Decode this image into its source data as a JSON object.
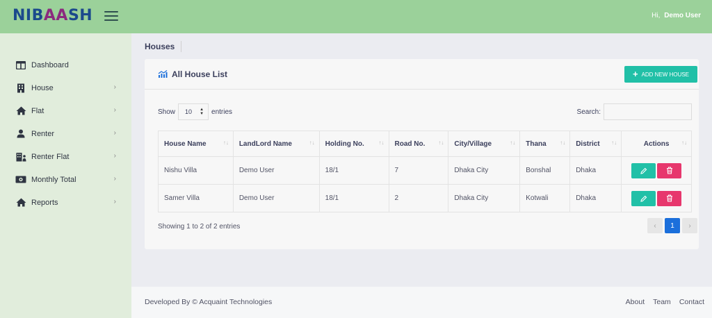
{
  "brand": {
    "logo_pre": "NIB",
    "logo_mid": "AA",
    "logo_post": "SH"
  },
  "header": {
    "greeting": "Hi,",
    "user_name": "Demo User"
  },
  "sidebar": {
    "items": [
      {
        "label": "Dashboard",
        "icon": "dashboard-icon",
        "has_chevron": false
      },
      {
        "label": "House",
        "icon": "building-icon",
        "has_chevron": true
      },
      {
        "label": "Flat",
        "icon": "home-icon",
        "has_chevron": true
      },
      {
        "label": "Renter",
        "icon": "user-icon",
        "has_chevron": true
      },
      {
        "label": "Renter Flat",
        "icon": "renter-flat-icon",
        "has_chevron": true
      },
      {
        "label": "Monthly Total",
        "icon": "money-icon",
        "has_chevron": true
      },
      {
        "label": "Reports",
        "icon": "home-icon",
        "has_chevron": true
      }
    ]
  },
  "breadcrumb": "Houses",
  "card": {
    "title": "All House List",
    "add_button": "ADD NEW HOUSE"
  },
  "controls": {
    "show_label": "Show",
    "entries_value": "10",
    "entries_label": "entries",
    "search_label": "Search:",
    "search_value": ""
  },
  "table": {
    "columns": [
      "House Name",
      "LandLord Name",
      "Holding No.",
      "Road No.",
      "City/Village",
      "Thana",
      "District",
      "Actions"
    ],
    "rows": [
      [
        "Nishu Villa",
        "Demo User",
        "18/1",
        "7",
        "Dhaka City",
        "Bonshal",
        "Dhaka"
      ],
      [
        "Samer Villa",
        "Demo User",
        "18/1",
        "2",
        "Dhaka City",
        "Kotwali",
        "Dhaka"
      ]
    ]
  },
  "pagination": {
    "info": "Showing 1 to 2 of 2 entries",
    "prev": "‹",
    "current": "1",
    "next": "›"
  },
  "footer": {
    "credit": "Developed By ©  Acquaint Technologies",
    "links": [
      "About",
      "Team",
      "Contact"
    ]
  },
  "colors": {
    "topbar": "#9bd19a",
    "sidebar": "#e1eddc",
    "accent_teal": "#21c0a7",
    "delete_pink": "#e7376d",
    "page_active": "#1b6fdb"
  }
}
